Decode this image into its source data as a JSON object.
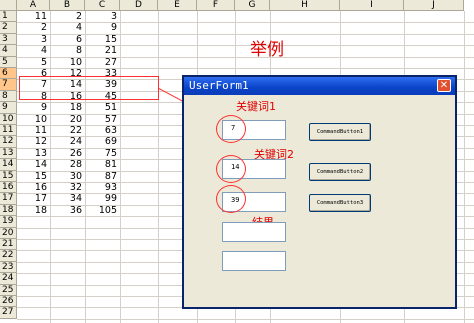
{
  "columns": [
    "A",
    "B",
    "C",
    "D",
    "E",
    "F",
    "G",
    "H",
    "I",
    "J"
  ],
  "rows": [
    "1",
    "2",
    "3",
    "4",
    "5",
    "6",
    "7",
    "8",
    "9",
    "10",
    "11",
    "12",
    "13",
    "14",
    "15",
    "16",
    "17",
    "18",
    "19",
    "20",
    "21",
    "22",
    "23",
    "24",
    "25",
    "26",
    "27"
  ],
  "row0": [
    "11",
    "2",
    "3"
  ],
  "data": [
    [
      "11",
      "2",
      "3"
    ],
    [
      "2",
      "4",
      "9"
    ],
    [
      "3",
      "6",
      "15"
    ],
    [
      "4",
      "8",
      "21"
    ],
    [
      "5",
      "10",
      "27"
    ],
    [
      "6",
      "12",
      "33"
    ],
    [
      "7",
      "14",
      "39"
    ],
    [
      "8",
      "16",
      "45"
    ],
    [
      "9",
      "18",
      "51"
    ],
    [
      "10",
      "20",
      "57"
    ],
    [
      "11",
      "22",
      "63"
    ],
    [
      "12",
      "24",
      "69"
    ],
    [
      "13",
      "26",
      "75"
    ],
    [
      "14",
      "28",
      "81"
    ],
    [
      "15",
      "30",
      "87"
    ],
    [
      "16",
      "32",
      "93"
    ],
    [
      "17",
      "34",
      "99"
    ],
    [
      "18",
      "36",
      "105"
    ]
  ],
  "example_label": "举例",
  "form": {
    "title": "UserForm1",
    "close": "✕",
    "keyword1_label": "关键词1",
    "keyword2_label": "关键词2",
    "result_label": "结果",
    "textbox1": "7",
    "textbox2": "14",
    "textbox3": "39",
    "textbox4": "",
    "textbox5": "",
    "button1": "CommandButton1",
    "button2": "CommandButton2",
    "button3": "CommandButton3"
  }
}
